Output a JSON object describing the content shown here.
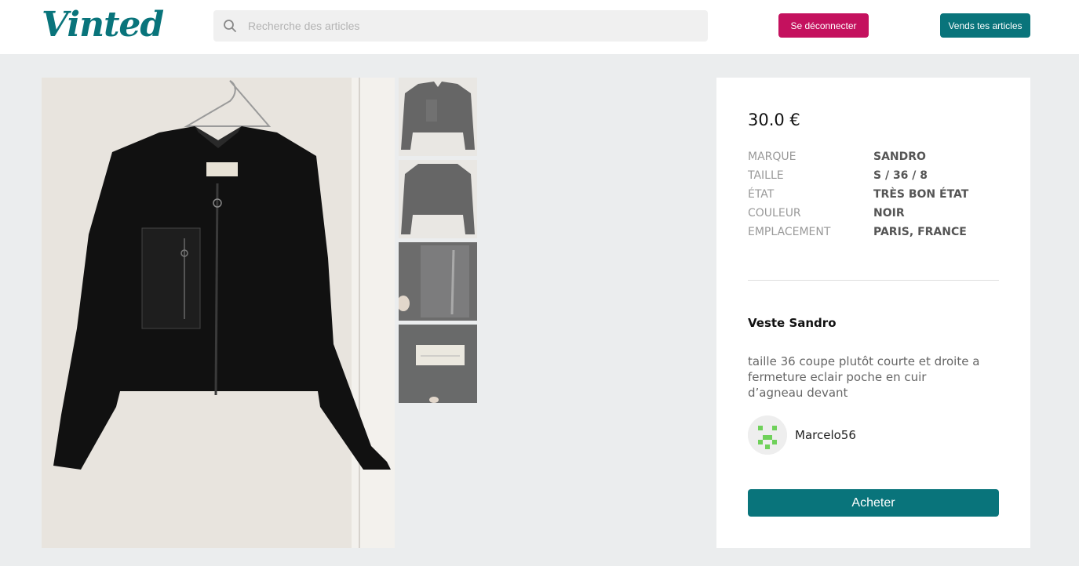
{
  "header": {
    "logo": "Vinted",
    "search_placeholder": "Recherche des articles",
    "logout_label": "Se déconnecter",
    "sell_label": "Vends tes articles",
    "icons": {
      "search": "search-icon"
    }
  },
  "colors": {
    "brand": "#09747b",
    "logout": "#c4115e",
    "background": "#ebedee"
  },
  "product": {
    "price": "30.0 €",
    "details": [
      {
        "key": "MARQUE",
        "value": "SANDRO"
      },
      {
        "key": "TAILLE",
        "value": "S / 36 / 8"
      },
      {
        "key": "ÉTAT",
        "value": "TRÈS BON ÉTAT"
      },
      {
        "key": "COULEUR",
        "value": "NOIR"
      },
      {
        "key": "EMPLACEMENT",
        "value": "PARIS, FRANCE"
      }
    ],
    "title": "Veste Sandro",
    "description": "taille 36 coupe plutôt courte et droite a fermeture eclair poche en cuir d’agneau devant",
    "seller": "Marcelo56",
    "buy_label": "Acheter"
  }
}
